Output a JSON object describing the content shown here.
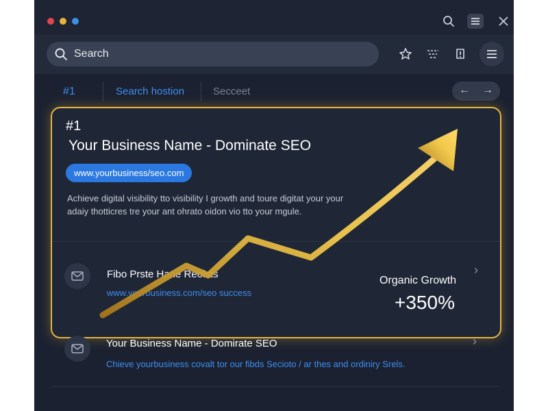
{
  "titlebar": {
    "icons": [
      "search-icon",
      "menu-icon",
      "close-icon"
    ]
  },
  "toolbar": {
    "search_placeholder": "Search",
    "icons": [
      "star-icon",
      "filter-icon",
      "alert-icon",
      "more-menu-icon"
    ]
  },
  "tabs": [
    {
      "label": "#1"
    },
    {
      "label": "Search hostion"
    },
    {
      "label": "Secceet"
    }
  ],
  "colors": {
    "accent": "#3f8ef0",
    "highlight": "#e7b73e",
    "background": "#1b2130"
  },
  "card": {
    "rank": "#1",
    "title": "Your Business Name - Dominate SEO",
    "url": "www.yourbusiness/seo.com",
    "description": "Achieve digital visibility tto visibility I growth and toure digitat your your adaiy thotticres tre your ant ohrato oidon vio tto your mgule.",
    "sub_result": {
      "title": "Fibo Prste Hane Reolsts",
      "url": "www.yourbusiness.com/seo success",
      "metric_label": "Organic Growth",
      "metric_value": "+350%"
    }
  },
  "results": [
    {
      "title": "Your Business Name - Domirate SEO",
      "description": "Chieve yourbusiness covalt tor our fibds Secioto / ar thes and ordiniry Srels."
    }
  ]
}
